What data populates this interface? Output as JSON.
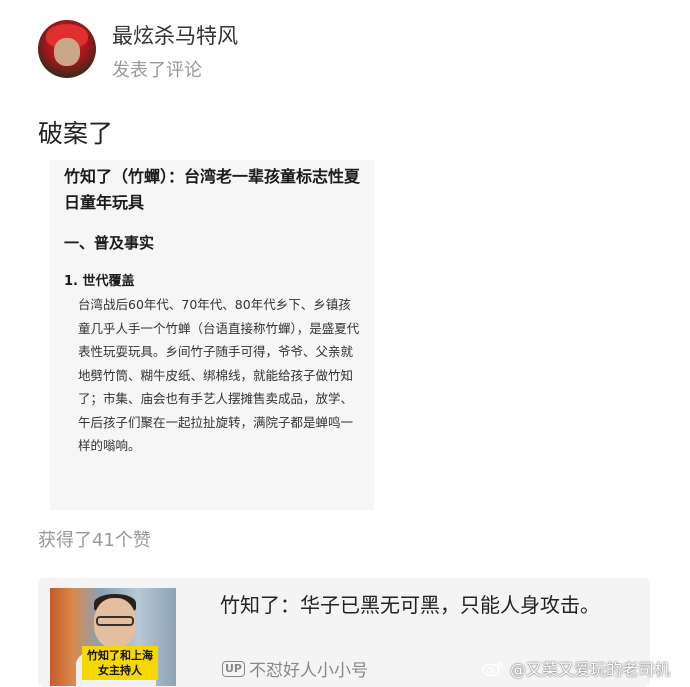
{
  "post": {
    "username": "最炫杀马特风",
    "action": "发表了评论",
    "comment": "破案了",
    "likes": "获得了41个赞"
  },
  "doc": {
    "title": "竹知了（竹蟬）：台湾老一辈孩童标志性夏日童年玩具",
    "heading": "一、普及事实",
    "item_title": "1. 世代覆盖",
    "body": "台湾战后60年代、70年代、80年代乡下、乡镇孩童几乎人手一个竹蝉（台语直接称竹蟬），是盛夏代表性玩耍玩具。乡间竹子随手可得，爷爷、父亲就地劈竹筒、糊牛皮纸、绑棉线，就能给孩子做竹知了；市集、庙会也有手艺人摆摊售卖成品，放学、午后孩子们聚在一起拉扯旋转，满院子都是蝉鸣一样的嗡响。"
  },
  "quote": {
    "title": "竹知了：华子已黑无可黑，只能人身攻击。",
    "thumb_caption": "竹知了和上海女主持人",
    "up_badge": "UP",
    "author": "不怼好人小小号"
  },
  "watermark": {
    "text": "@又菜又爱玩的老司机",
    "icon": "weibo-icon"
  }
}
